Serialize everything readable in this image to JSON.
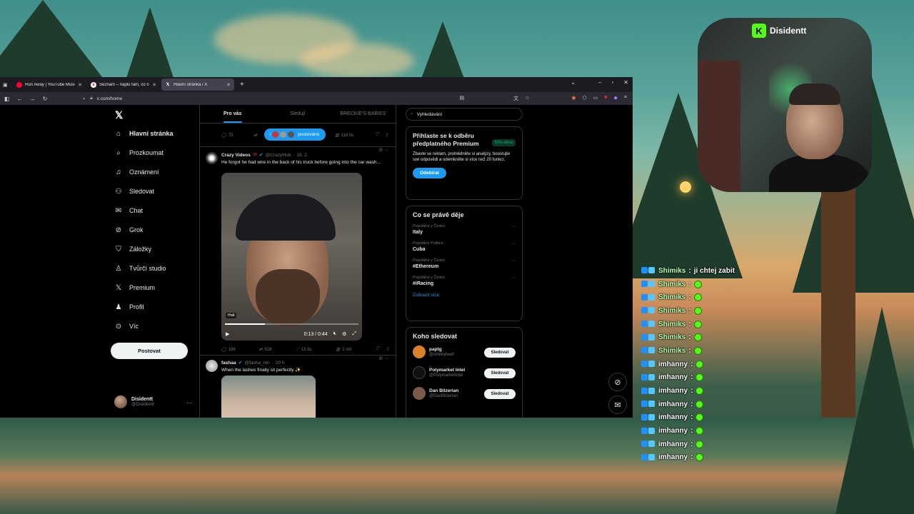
{
  "browser": {
    "tabs": [
      {
        "label": "Run Away | YouTube Music",
        "favicon_color": "#ff0033",
        "active": false
      },
      {
        "label": "Seznam – najdu tam, co nezná…",
        "favicon_color": "#ffffff",
        "active": false
      },
      {
        "label": "Hlavní stránka / X",
        "favicon_color": "#ffffff",
        "active": true
      }
    ],
    "url": "x.com/home"
  },
  "x": {
    "nav": [
      {
        "label": "Hlavní stránka",
        "icon": "home-icon"
      },
      {
        "label": "Prozkoumat",
        "icon": "search-icon"
      },
      {
        "label": "Oznámení",
        "icon": "bell-icon"
      },
      {
        "label": "Sledovat",
        "icon": "follow-icon"
      },
      {
        "label": "Chat",
        "icon": "mail-icon"
      },
      {
        "label": "Grok",
        "icon": "grok-icon"
      },
      {
        "label": "Záložky",
        "icon": "bookmark-icon"
      },
      {
        "label": "Tvůrčí studio",
        "icon": "studio-icon"
      },
      {
        "label": "Premium",
        "icon": "x-icon"
      },
      {
        "label": "Profil",
        "icon": "profile-icon"
      },
      {
        "label": "Víc",
        "icon": "more-icon"
      }
    ],
    "post_button": "Postovat",
    "profile": {
      "name": "Disidentt",
      "handle": "@Disidentt"
    },
    "feed_tabs": [
      "Pro vás",
      "Sledují",
      "BRECKIE'S BABIES"
    ],
    "posted_pill": "postováno",
    "top_actions": {
      "replies": "73",
      "views": "116 tis."
    },
    "tweet1": {
      "name": "Crazy Videos",
      "age_badge": "18",
      "handle": "@CrazyHub",
      "date": "28. 2.",
      "text": "He forgot he had wire in the back of his truck before going into the car wash...",
      "video_tag": "Hrát",
      "time": "0:13 / 0:44",
      "progress": 0.3,
      "replies": "186",
      "reposts": "528",
      "likes": "13 tis.",
      "views": "2 mil."
    },
    "tweet2": {
      "name": "fashaa",
      "handle": "@fasha_ntn",
      "date": "20 h",
      "text": "When the lashes finally sit perfectly"
    },
    "search_placeholder": "Vyhledávání",
    "premium": {
      "title": "Přihlaste se k odběru předplatného Premium",
      "badge": "50% sleva",
      "text": "Zbavte se reklam, prohlédněte si analýzy, boostujte své odpovědi a odemkněte si více než 20 funkcí.",
      "button": "Odebírat"
    },
    "trends": {
      "title": "Co se právě děje",
      "items": [
        {
          "category": "Populární v Česko",
          "name": "Italy"
        },
        {
          "category": "Populární Politics",
          "name": "Cuba"
        },
        {
          "category": "Populární v Česko",
          "name": "#Ethereum"
        },
        {
          "category": "Populární v Česko",
          "name": "#iRacing"
        }
      ],
      "show_more": "Zobrazit více"
    },
    "who_to_follow": {
      "title": "Koho sledovat",
      "items": [
        {
          "name": "paptg",
          "handle": "@smileybeef",
          "avatar_color": "#d9822b"
        },
        {
          "name": "Polymarket Intel",
          "handle": "@PolymarketIntel",
          "avatar_color": "#111111"
        },
        {
          "name": "Dan Bilzerian",
          "handle": "@DanBilzerian",
          "avatar_color": "#7a5a4a"
        }
      ],
      "button": "Sledovat"
    }
  },
  "stream": {
    "channel_name": "Disidentt",
    "kick_logo": "K",
    "chat": [
      {
        "user": "Shimiks",
        "msg": "ji chtej zabit",
        "emote": false
      },
      {
        "user": "Shimiks",
        "msg": "",
        "emote": true
      },
      {
        "user": "Shimiks",
        "msg": "",
        "emote": true
      },
      {
        "user": "Shimiks",
        "msg": "",
        "emote": true
      },
      {
        "user": "Shimiks",
        "msg": "",
        "emote": true
      },
      {
        "user": "Shimiks",
        "msg": "",
        "emote": true
      },
      {
        "user": "Shimiks",
        "msg": "",
        "emote": true
      },
      {
        "user": "imhanny",
        "msg": "",
        "emote": true
      },
      {
        "user": "imhanny",
        "msg": "",
        "emote": true
      },
      {
        "user": "imhanny",
        "msg": "",
        "emote": true
      },
      {
        "user": "imhanny",
        "msg": "",
        "emote": true
      },
      {
        "user": "imhanny",
        "msg": "",
        "emote": true
      },
      {
        "user": "imhanny",
        "msg": "",
        "emote": true
      },
      {
        "user": "imhanny",
        "msg": "",
        "emote": true
      },
      {
        "user": "imhanny",
        "msg": "",
        "emote": true
      }
    ]
  }
}
